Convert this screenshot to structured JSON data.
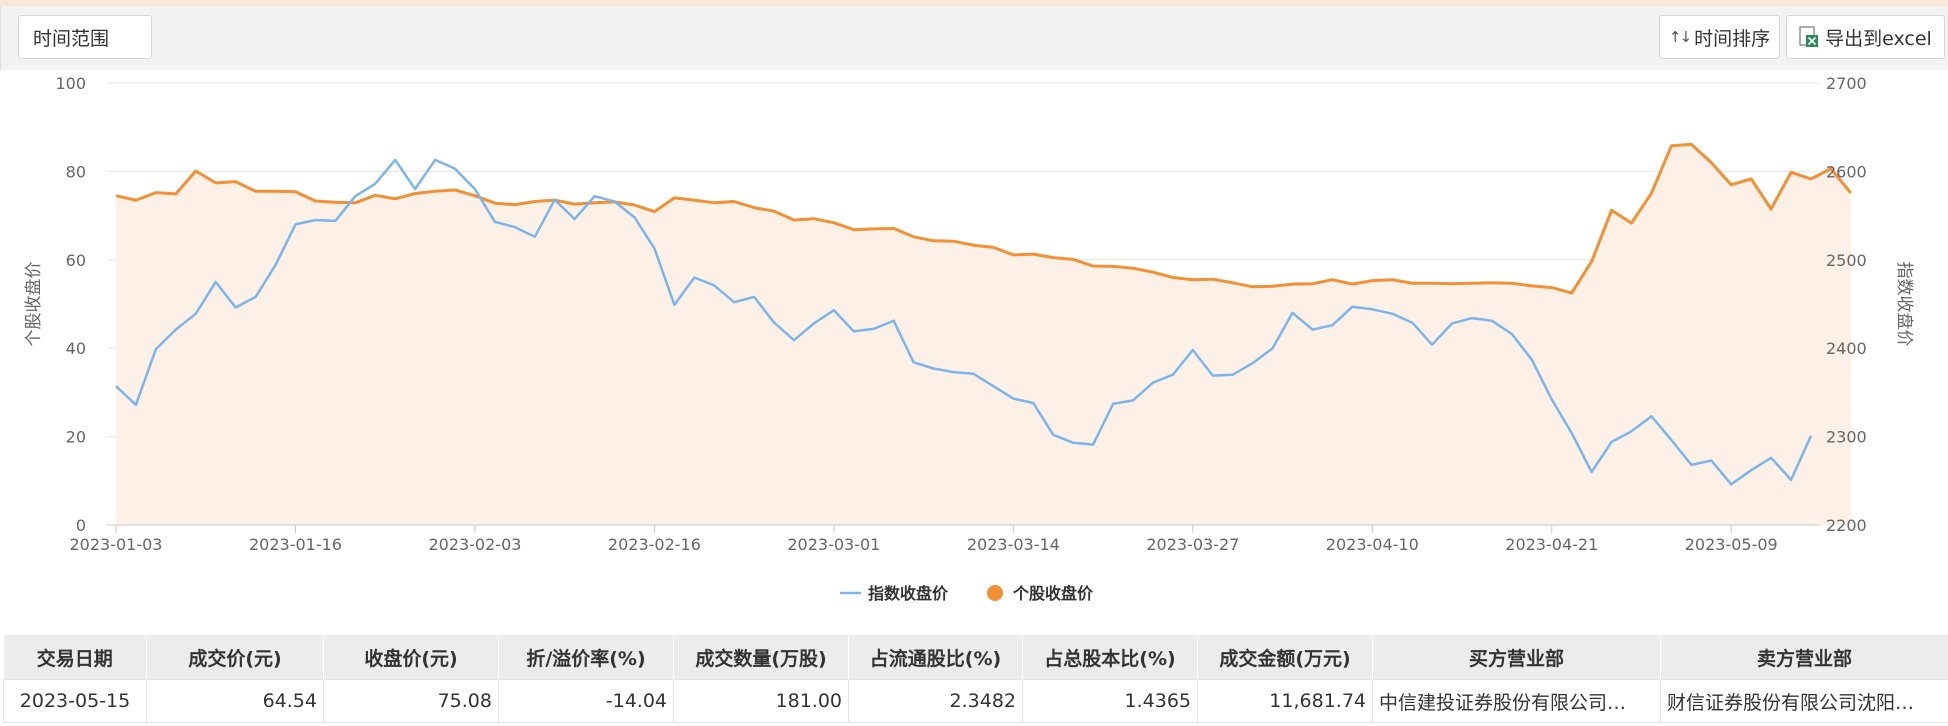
{
  "toolbar": {
    "range_label": "时间范围",
    "sort_label": "时间排序",
    "export_label": "导出到excel",
    "sort_icon": "sort-arrows-icon",
    "export_icon": "excel-icon"
  },
  "chart_data": {
    "type": "line",
    "colors": {
      "index": "#7cb5ec",
      "stock": "#f19035",
      "area": "#fdf0e6"
    },
    "y_left": {
      "label": "个股收盘价",
      "range": [
        0,
        100
      ],
      "ticks": [
        "0",
        "20",
        "40",
        "60",
        "80",
        "100"
      ]
    },
    "y_right": {
      "label": "指数收盘价",
      "range": [
        2200,
        2700
      ],
      "ticks": [
        "2200",
        "2300",
        "2400",
        "2500",
        "2600",
        "2700"
      ]
    },
    "x_ticks": [
      "2023-01-03",
      "2023-01-16",
      "2023-02-03",
      "2023-02-16",
      "2023-03-01",
      "2023-03-14",
      "2023-03-27",
      "2023-04-10",
      "2023-04-21",
      "2023-05-09"
    ],
    "x_tick_index": [
      0,
      9,
      18,
      27,
      36,
      45,
      54,
      63,
      72,
      81
    ],
    "grid": true,
    "legend_position": "bottom-center",
    "series": [
      {
        "name": "指数收盘价",
        "axis": "right",
        "values": [
          2357,
          2336,
          2399,
          2421,
          2439,
          2475,
          2446,
          2458,
          2494,
          2540,
          2545,
          2544,
          2572,
          2586,
          2613,
          2580,
          2613,
          2603,
          2580,
          2543,
          2537,
          2526,
          2568,
          2546,
          2572,
          2566,
          2548,
          2513,
          2449,
          2480,
          2471,
          2452,
          2458,
          2429,
          2409,
          2428,
          2443,
          2419,
          2422,
          2431,
          2384,
          2377,
          2373,
          2371,
          2357,
          2343,
          2338,
          2302,
          2293,
          2291,
          2337,
          2341,
          2361,
          2370,
          2398,
          2369,
          2370,
          2383,
          2400,
          2440,
          2421,
          2426,
          2447,
          2444,
          2439,
          2429,
          2404,
          2428,
          2434,
          2431,
          2416,
          2387,
          2342,
          2304,
          2260,
          2294,
          2306,
          2323,
          2296,
          2268,
          2273,
          2246,
          2262,
          2276,
          2251,
          2301
        ]
      },
      {
        "name": "个股收盘价",
        "axis": "left",
        "values": [
          74.5,
          73.5,
          75.2,
          74.9,
          80.1,
          77.4,
          77.7,
          75.5,
          75.5,
          75.4,
          73.3,
          73.0,
          72.9,
          74.6,
          73.8,
          75.0,
          75.5,
          75.8,
          74.5,
          72.8,
          72.5,
          73.2,
          73.5,
          72.6,
          72.9,
          73.1,
          72.4,
          70.9,
          74.0,
          73.5,
          72.9,
          73.2,
          71.8,
          71.0,
          69.0,
          69.3,
          68.4,
          66.8,
          67.0,
          67.1,
          65.2,
          64.3,
          64.2,
          63.3,
          62.8,
          61.1,
          61.3,
          60.5,
          60.1,
          58.6,
          58.5,
          58.1,
          57.2,
          56.0,
          55.5,
          55.6,
          54.8,
          53.9,
          54.0,
          54.5,
          54.6,
          55.5,
          54.5,
          55.3,
          55.5,
          54.7,
          54.7,
          54.6,
          54.7,
          54.8,
          54.7,
          54.1,
          53.7,
          52.5,
          59.6,
          71.2,
          68.3,
          75.1,
          85.8,
          86.1,
          82.0,
          77.0,
          78.3,
          71.5,
          79.8,
          78.3,
          80.6,
          75.1
        ]
      }
    ]
  },
  "table": {
    "headers": [
      "交易日期",
      "成交价(元)",
      "收盘价(元)",
      "折/溢价率(%)",
      "成交数量(万股)",
      "占流通股比(%)",
      "占总股本比(%)",
      "成交金额(万元)",
      "买方营业部",
      "卖方营业部"
    ],
    "rows": [
      [
        "2023-05-15",
        "64.54",
        "75.08",
        "-14.04",
        "181.00",
        "2.3482",
        "1.4365",
        "11,681.74",
        "中信建投证券股份有限公司…",
        "财信证券股份有限公司沈阳…"
      ]
    ]
  }
}
